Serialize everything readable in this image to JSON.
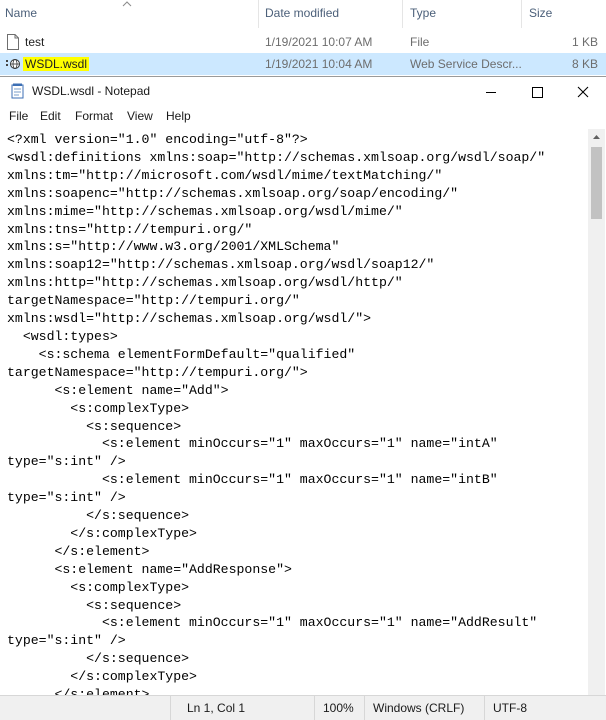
{
  "explorer": {
    "columns": {
      "name": "Name",
      "date": "Date modified",
      "type": "Type",
      "size": "Size"
    },
    "files": [
      {
        "name": "test",
        "date": "1/19/2021 10:07 AM",
        "type": "File",
        "size": "1 KB",
        "icon": "file-icon",
        "selected": false
      },
      {
        "name": "WSDL.wsdl",
        "date": "1/19/2021 10:04 AM",
        "type": "Web Service Descr...",
        "size": "8 KB",
        "icon": "web-service-file-icon",
        "selected": true
      }
    ]
  },
  "notepad": {
    "title": "WSDL.wsdl - Notepad",
    "menu": [
      "File",
      "Edit",
      "Format",
      "View",
      "Help"
    ],
    "content": "<?xml version=\"1.0\" encoding=\"utf-8\"?>\n<wsdl:definitions xmlns:soap=\"http://schemas.xmlsoap.org/wsdl/soap/\"\nxmlns:tm=\"http://microsoft.com/wsdl/mime/textMatching/\"\nxmlns:soapenc=\"http://schemas.xmlsoap.org/soap/encoding/\"\nxmlns:mime=\"http://schemas.xmlsoap.org/wsdl/mime/\"\nxmlns:tns=\"http://tempuri.org/\"\nxmlns:s=\"http://www.w3.org/2001/XMLSchema\"\nxmlns:soap12=\"http://schemas.xmlsoap.org/wsdl/soap12/\"\nxmlns:http=\"http://schemas.xmlsoap.org/wsdl/http/\"\ntargetNamespace=\"http://tempuri.org/\"\nxmlns:wsdl=\"http://schemas.xmlsoap.org/wsdl/\">\n  <wsdl:types>\n    <s:schema elementFormDefault=\"qualified\"\ntargetNamespace=\"http://tempuri.org/\">\n      <s:element name=\"Add\">\n        <s:complexType>\n          <s:sequence>\n            <s:element minOccurs=\"1\" maxOccurs=\"1\" name=\"intA\"\ntype=\"s:int\" />\n            <s:element minOccurs=\"1\" maxOccurs=\"1\" name=\"intB\"\ntype=\"s:int\" />\n          </s:sequence>\n        </s:complexType>\n      </s:element>\n      <s:element name=\"AddResponse\">\n        <s:complexType>\n          <s:sequence>\n            <s:element minOccurs=\"1\" maxOccurs=\"1\" name=\"AddResult\"\ntype=\"s:int\" />\n          </s:sequence>\n        </s:complexType>\n      </s:element>",
    "status": {
      "position": "Ln 1, Col 1",
      "zoom": "100%",
      "line_ending": "Windows (CRLF)",
      "encoding": "UTF-8"
    }
  },
  "colors": {
    "selection": "#cce8ff",
    "highlight": "#ffff00",
    "statusbar": "#f0f0f0"
  }
}
